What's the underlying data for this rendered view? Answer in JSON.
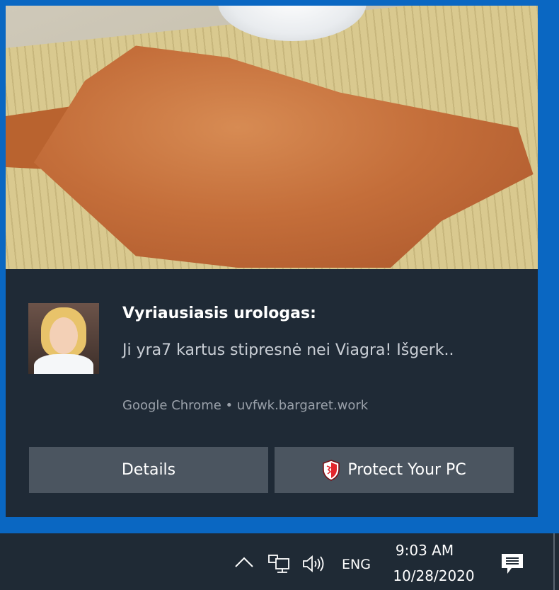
{
  "notification": {
    "title": "Vyriausiasis urologas:",
    "message": "Ji yra7 kartus stipresnė nei Viagra! Išgerk..",
    "attribution": "Google Chrome • uvfwk.bargaret.work",
    "buttons": {
      "details": "Details",
      "protect": "Protect Your PC"
    },
    "hero_image": "food-photo",
    "avatar_image": "woman-portrait"
  },
  "taskbar": {
    "language": "ENG",
    "time": "9:03 AM",
    "date": "10/28/2020",
    "icons": [
      "chevron-up-icon",
      "network-icon",
      "volume-icon",
      "action-center-icon"
    ]
  },
  "colors": {
    "desktop_blue": "#0a67c2",
    "toast_background": "#1f2a36",
    "button_background": "#4b5560",
    "taskbar_background": "#1f2a35"
  }
}
